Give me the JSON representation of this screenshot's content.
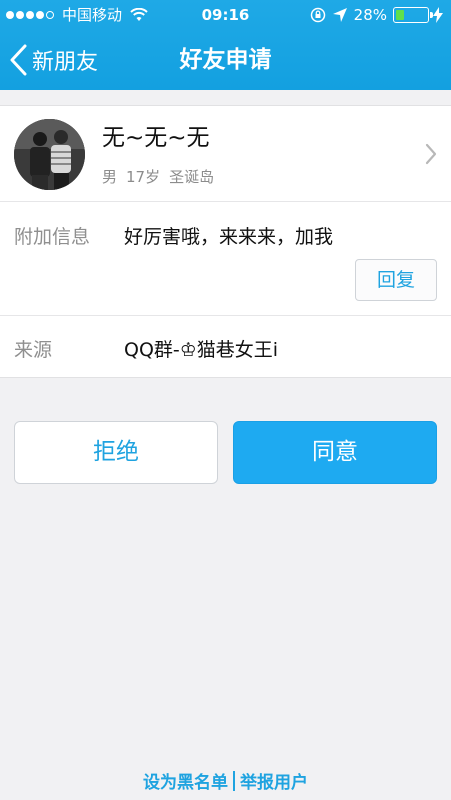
{
  "status_bar": {
    "carrier": "中国移动",
    "time": "09:16",
    "battery_percent": "28%",
    "battery_level": 0.28
  },
  "nav": {
    "back_label": "新朋友",
    "title": "好友申请"
  },
  "profile": {
    "nickname": "无~无~无",
    "gender": "男",
    "age": "17岁",
    "location": "圣诞岛"
  },
  "info": {
    "extra_label": "附加信息",
    "extra_value": "好厉害哦，来来来，加我",
    "reply_label": "回复",
    "source_label": "来源",
    "source_value": "QQ群-♔猫巷女王i"
  },
  "actions": {
    "reject_label": "拒绝",
    "accept_label": "同意"
  },
  "footer": {
    "blacklist_label": "设为黑名单",
    "report_label": "举报用户"
  },
  "colors": {
    "brand": "#13a0e0",
    "accent_button": "#1eaaf1",
    "link": "#1fa3e0"
  }
}
